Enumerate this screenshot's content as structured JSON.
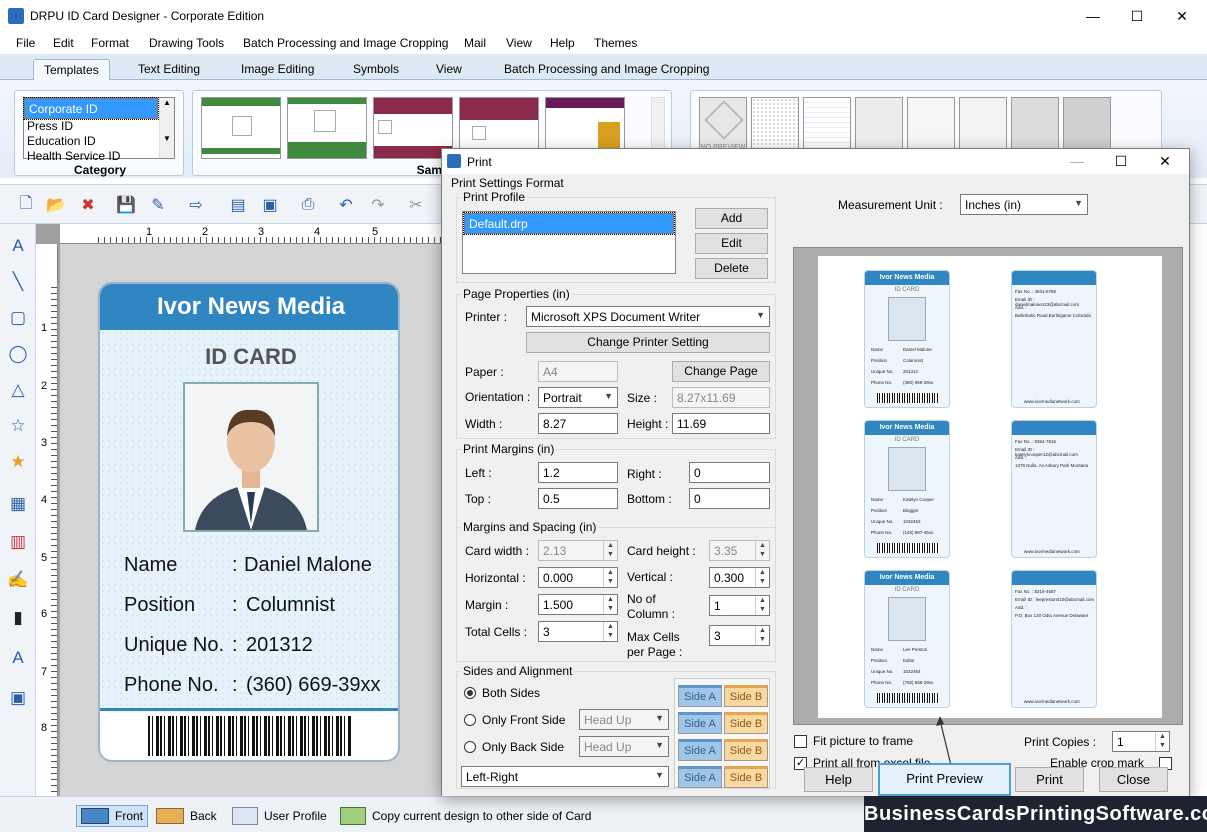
{
  "app": {
    "title": "DRPU ID Card Designer - Corporate Edition",
    "min": "—",
    "max": "☐",
    "close": "✕"
  },
  "menu": [
    "File",
    "Edit",
    "Format",
    "Drawing Tools",
    "Batch Processing and Image Cropping",
    "Mail",
    "View",
    "Help",
    "Themes"
  ],
  "ribbon_tabs": [
    "Templates",
    "Text Editing",
    "Image Editing",
    "Symbols",
    "View",
    "Batch Processing and Image Cropping"
  ],
  "category": {
    "label": "Category",
    "items": [
      "Corporate ID",
      "Press ID",
      "Education ID",
      "Health Service ID"
    ]
  },
  "samples": {
    "label": "Samp"
  },
  "card": {
    "header": "Ivor News Media",
    "title": "ID CARD",
    "rows": [
      {
        "label": "Name",
        "colon": ":",
        "value": "Daniel Malone"
      },
      {
        "label": "Position",
        "colon": ":",
        "value": "Columnist"
      },
      {
        "label": "Unique No.",
        "colon": ":",
        "value": "201312"
      },
      {
        "label": "Phone No.",
        "colon": ":",
        "value": "(360) 669-39xx"
      }
    ]
  },
  "ruler": {
    "h": [
      "1",
      "2",
      "3",
      "4",
      "5"
    ],
    "v": [
      "1",
      "2",
      "3",
      "4",
      "5",
      "6",
      "7",
      "8"
    ]
  },
  "statusbar": {
    "front": "Front",
    "back": "Back",
    "user_profile": "User Profile",
    "copy": "Copy current design to other side of Card"
  },
  "watermark": "BusinessCardsPrintingSoftware.com",
  "dialog": {
    "title": "Print",
    "group_title": "Print Settings Format",
    "print_profile": {
      "legend": "Print Profile",
      "items": [
        "Default.drp"
      ],
      "add": "Add",
      "edit": "Edit",
      "delete": "Delete"
    },
    "page_properties": {
      "legend": "Page Properties  (in)",
      "printer_label": "Printer :",
      "printer_value": "Microsoft XPS Document Writer",
      "change_printer": "Change Printer Setting",
      "paper_label": "Paper :",
      "paper_value": "A4",
      "change_page": "Change Page",
      "orientation_label": "Orientation :",
      "orientation_value": "Portrait",
      "size_label": "Size :",
      "size_value": "8.27x11.69",
      "width_label": "Width :",
      "width_value": "8.27",
      "height_label": "Height :",
      "height_value": "11.69"
    },
    "print_margins": {
      "legend": "Print Margins (in)",
      "left_label": "Left :",
      "left_value": "1.2",
      "right_label": "Right :",
      "right_value": "0",
      "top_label": "Top :",
      "top_value": "0.5",
      "bottom_label": "Bottom :",
      "bottom_value": "0"
    },
    "margins_spacing": {
      "legend": "Margins and Spacing  (in)",
      "card_width_label": "Card width :",
      "card_width_value": "2.13",
      "card_height_label": "Card height :",
      "card_height_value": "3.35",
      "horizontal_label": "Horizontal :",
      "horizontal_value": "0.000",
      "vertical_label": "Vertical :",
      "vertical_value": "0.300",
      "margin_label": "Margin :",
      "margin_value": "1.500",
      "columns_label_1": "No of",
      "columns_label_2": "Column :",
      "columns_value": "1",
      "total_cells_label": "Total Cells :",
      "total_cells_value": "3",
      "max_cells_label_1": "Max Cells",
      "max_cells_label_2": "per Page :",
      "max_cells_value": "3"
    },
    "sides": {
      "legend": "Sides and Alignment",
      "both": "Both Sides",
      "front_only": "Only Front Side",
      "back_only": "Only Back Side",
      "head_up_1": "Head Up",
      "head_up_2": "Head Up",
      "alignment": "Left-Right",
      "side_a": "Side A",
      "side_b": "Side B"
    },
    "measurement": {
      "label": "Measurement Unit :",
      "value": "Inches (in)"
    },
    "fit_picture": "Fit picture to frame",
    "print_all_excel": "Print all from excel file",
    "print_copies_label": "Print Copies :",
    "print_copies_value": "1",
    "enable_crop": "Enable crop mark",
    "buttons": {
      "help": "Help",
      "print_preview": "Print Preview",
      "print": "Print",
      "close": "Close"
    }
  },
  "preview_cards": [
    {
      "header": "Ivor News Media",
      "title": "ID CARD",
      "name": "Daniel Malone",
      "position": "Columnist",
      "unique": "201312",
      "phone": "(360) 669-39xx",
      "back_fax": "Fax No. : 4931-6786",
      "back_email": "Email ID : danielmalone123@abcmail.com",
      "back_addr": "Bellinbulio Road,Burlingame Colorado",
      "site": "www.ivormedianetwork.com"
    },
    {
      "header": "Ivor News Media",
      "title": "ID CARD",
      "name": "Katelyn Cooper",
      "position": "Blogger",
      "unique": "1032453",
      "phone": "(145) 987-45xx",
      "back_fax": "Fax No. : 9364-7816",
      "back_email": "Email ID : katelyncooper12@abcmail.com",
      "back_addr": "1379 Nulla. Av.Asbury Park Montana",
      "site": "www.ivormedianetwork.com"
    },
    {
      "header": "Ivor News Media",
      "title": "ID CARD",
      "name": "Lee Preston",
      "position": "Editor",
      "unique": "1032454",
      "phone": "(750) 558-29xx",
      "back_fax": "Fax No. : 8216-4687",
      "back_email": "Email ID : leepreston010@abcmail.com",
      "back_addr": "P.O. Box 120 Odio Avenue Delaware",
      "site": "www.ivormedianetwork.com"
    }
  ],
  "preview_field_labels": {
    "name": "Name",
    "position": "Position",
    "unique": "Unique No.",
    "phone": "Phone No.",
    "addr": "Add. :"
  }
}
